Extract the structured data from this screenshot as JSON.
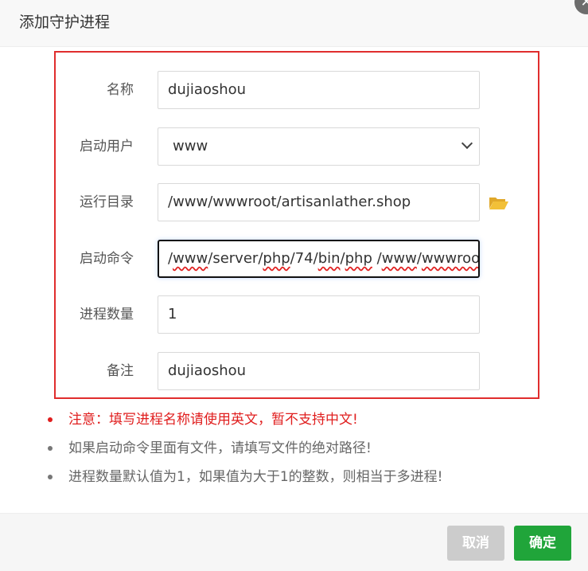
{
  "dialog": {
    "title": "添加守护进程",
    "close_symbol": "✕"
  },
  "form": {
    "name": {
      "label": "名称",
      "value": "dujiaoshou"
    },
    "user": {
      "label": "启动用户",
      "value": "www"
    },
    "run_dir": {
      "label": "运行目录",
      "value": "/www/wwwroot/artisanlather.shop",
      "icon": "folder-open-icon"
    },
    "command": {
      "label": "启动命令",
      "segments": [
        "/",
        "www",
        "/",
        "server",
        "/",
        "php",
        "/74/",
        "bin",
        "/",
        "php",
        " /",
        "www",
        "/",
        "wwwroo"
      ]
    },
    "process_count": {
      "label": "进程数量",
      "value": "1"
    },
    "remark": {
      "label": "备注",
      "value": "dujiaoshou"
    }
  },
  "notes": [
    {
      "text": "注意：填写进程名称请使用英文，暂不支持中文!",
      "type": "warning"
    },
    {
      "text": "如果启动命令里面有文件，请填写文件的绝对路径!",
      "type": "info"
    },
    {
      "text": "进程数量默认值为1，如果值为大于1的整数，则相当于多进程!",
      "type": "info"
    }
  ],
  "footer": {
    "cancel_label": "取消",
    "confirm_label": "确定"
  },
  "colors": {
    "accent_green": "#20a53a",
    "highlight_red": "#e02d2d",
    "cancel_gray": "#cccccc",
    "folder_yellow": "#f2c038"
  }
}
